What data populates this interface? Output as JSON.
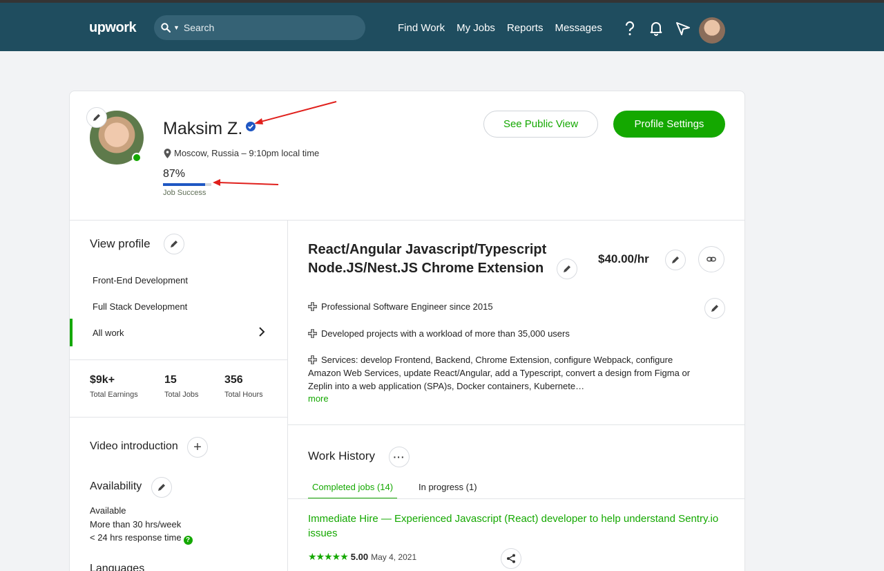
{
  "nav": {
    "logo": "upwork",
    "search_placeholder": "Search",
    "links": [
      "Find Work",
      "My Jobs",
      "Reports",
      "Messages"
    ]
  },
  "profile": {
    "name": "Maksim Z.",
    "location": "Moscow, Russia – 9:10pm local time",
    "job_success_value": "87%",
    "job_success_fraction": 0.87,
    "job_success_label": "Job Success",
    "see_public_view": "See Public View",
    "profile_settings": "Profile Settings"
  },
  "sidebar": {
    "view_profile": "View profile",
    "categories": [
      "Front-End Development",
      "Full Stack Development",
      "All work"
    ],
    "stats": [
      {
        "value": "$9k+",
        "label": "Total Earnings"
      },
      {
        "value": "15",
        "label": "Total Jobs"
      },
      {
        "value": "356",
        "label": "Total Hours"
      }
    ],
    "video_intro": "Video introduction",
    "availability": "Availability",
    "availability_lines": [
      "Available",
      "More than 30 hrs/week",
      "< 24 hrs response time"
    ],
    "languages": "Languages"
  },
  "main": {
    "title": "React/Angular Javascript/Typescript Node.JS/Nest.JS Chrome Extension",
    "rate": "$40.00/hr",
    "desc": [
      "Professional Software Engineer since 2015",
      "Developed projects with a workload of more than 35,000 users",
      "Services: develop Frontend, Backend, Chrome Extension, configure Webpack, configure Amazon Web Services, update React/Angular, add a Typescript, convert a design from Figma or Zeplin into a web application (SPA)s, Docker containers, Kubernete…"
    ],
    "more": "more",
    "work_history": "Work History",
    "tabs": [
      "Completed jobs (14)",
      "In progress (1)"
    ],
    "job": {
      "title": "Immediate Hire — Experienced Javascript (React) developer to help understand Sentry.io issues",
      "stars": "★★★★★",
      "score": "5.00",
      "date": "May 4, 2021"
    }
  },
  "colors": {
    "nav_bg": "#1f4d5f",
    "accent_green": "#14a800",
    "verified_blue": "#1f57c3",
    "annotation_red": "#e0201c"
  }
}
